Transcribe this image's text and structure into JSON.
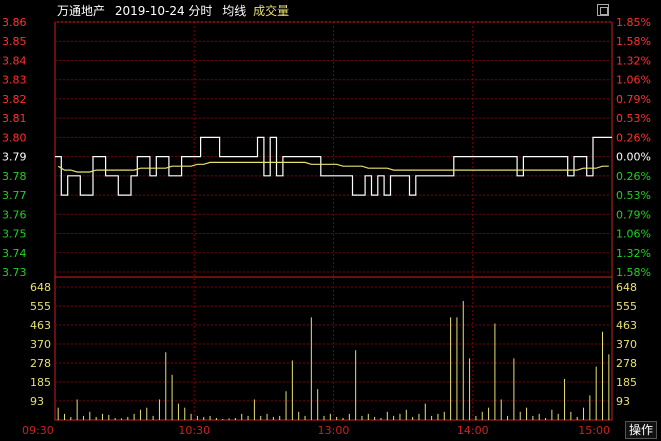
{
  "header": {
    "stock_name": "万通地产",
    "date_mode": "2019-10-24 分时",
    "avg_label": "均线",
    "vol_label": "成交量"
  },
  "toolbar": {
    "op_label": "操作"
  },
  "colors": {
    "price": "#ffffff",
    "avg": "#e8e070",
    "vol": "#e8e070",
    "grid": "#7a0000",
    "axis": "#cc2020",
    "up": "#ff3030",
    "down": "#20d020",
    "neutral": "#ffffff",
    "time": "#cc2020"
  },
  "chart_data": {
    "type": "line",
    "price_ticks": [
      "3.86",
      "3.85",
      "3.84",
      "3.83",
      "3.82",
      "3.81",
      "3.80",
      "3.79",
      "3.78",
      "3.77",
      "3.76",
      "3.75",
      "3.74",
      "3.73"
    ],
    "pct_ticks": [
      "1.85%",
      "1.58%",
      "1.32%",
      "1.06%",
      "0.79%",
      "0.53%",
      "0.26%",
      "0.00%",
      "0.26%",
      "0.53%",
      "0.79%",
      "1.06%",
      "1.32%",
      "1.58%"
    ],
    "vol_ticks": [
      "648",
      "555",
      "463",
      "370",
      "278",
      "185",
      "93"
    ],
    "time_ticks": [
      "09:30",
      "10:30",
      "13:00",
      "14:00",
      "15:00"
    ],
    "price_range": [
      3.73,
      3.86
    ],
    "volume_max": 648,
    "prev_close": 3.79,
    "price": [
      3.79,
      3.77,
      3.78,
      3.78,
      3.77,
      3.77,
      3.79,
      3.79,
      3.78,
      3.78,
      3.77,
      3.77,
      3.78,
      3.79,
      3.79,
      3.78,
      3.79,
      3.79,
      3.78,
      3.78,
      3.79,
      3.79,
      3.79,
      3.8,
      3.8,
      3.8,
      3.79,
      3.79,
      3.79,
      3.79,
      3.79,
      3.79,
      3.8,
      3.78,
      3.8,
      3.78,
      3.79,
      3.79,
      3.79,
      3.79,
      3.79,
      3.79,
      3.78,
      3.78,
      3.78,
      3.78,
      3.78,
      3.77,
      3.77,
      3.78,
      3.77,
      3.78,
      3.77,
      3.78,
      3.78,
      3.78,
      3.77,
      3.78,
      3.78,
      3.78,
      3.78,
      3.78,
      3.78,
      3.79,
      3.79,
      3.79,
      3.79,
      3.79,
      3.79,
      3.79,
      3.79,
      3.79,
      3.79,
      3.78,
      3.79,
      3.79,
      3.79,
      3.79,
      3.79,
      3.79,
      3.79,
      3.78,
      3.79,
      3.79,
      3.78,
      3.8,
      3.8,
      3.8
    ],
    "avg": [
      3.785,
      3.783,
      3.783,
      3.782,
      3.782,
      3.782,
      3.783,
      3.783,
      3.783,
      3.783,
      3.783,
      3.783,
      3.783,
      3.784,
      3.784,
      3.784,
      3.784,
      3.784,
      3.785,
      3.785,
      3.785,
      3.785,
      3.786,
      3.786,
      3.787,
      3.787,
      3.787,
      3.787,
      3.787,
      3.787,
      3.787,
      3.787,
      3.787,
      3.787,
      3.787,
      3.787,
      3.787,
      3.787,
      3.787,
      3.787,
      3.786,
      3.786,
      3.786,
      3.786,
      3.786,
      3.785,
      3.785,
      3.785,
      3.785,
      3.784,
      3.784,
      3.784,
      3.784,
      3.783,
      3.783,
      3.783,
      3.783,
      3.783,
      3.783,
      3.783,
      3.783,
      3.783,
      3.783,
      3.783,
      3.783,
      3.783,
      3.783,
      3.783,
      3.783,
      3.783,
      3.783,
      3.783,
      3.783,
      3.783,
      3.783,
      3.783,
      3.783,
      3.783,
      3.783,
      3.783,
      3.783,
      3.783,
      3.783,
      3.784,
      3.784,
      3.784,
      3.785,
      3.785
    ],
    "volume": [
      60,
      30,
      15,
      100,
      20,
      40,
      15,
      30,
      25,
      10,
      8,
      15,
      30,
      50,
      60,
      20,
      100,
      330,
      220,
      80,
      60,
      30,
      20,
      15,
      20,
      10,
      5,
      8,
      10,
      30,
      20,
      100,
      20,
      30,
      15,
      20,
      140,
      290,
      40,
      20,
      500,
      150,
      20,
      30,
      15,
      10,
      30,
      340,
      20,
      30,
      15,
      10,
      40,
      20,
      30,
      50,
      15,
      30,
      80,
      20,
      30,
      40,
      500,
      500,
      580,
      300,
      20,
      40,
      60,
      470,
      100,
      20,
      300,
      40,
      60,
      20,
      30,
      10,
      50,
      30,
      200,
      40,
      15,
      60,
      120,
      260,
      430,
      320
    ]
  }
}
